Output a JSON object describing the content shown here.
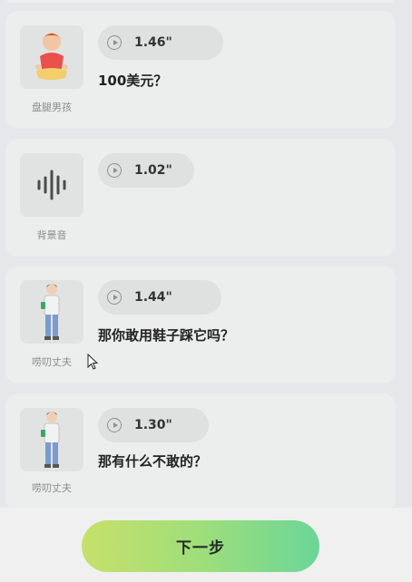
{
  "messages": [
    {
      "role": "盘腿男孩",
      "duration": "1.46\"",
      "text": "100美元？",
      "avatar": "boy-cross-legged-icon"
    },
    {
      "role": "背景音",
      "duration": "1.02\"",
      "text": "",
      "avatar": "sound-wave-icon"
    },
    {
      "role": "唠叨丈夫",
      "duration": "1.44\"",
      "text": "那你敢用鞋子踩它吗？",
      "avatar": "husband-figure-icon"
    },
    {
      "role": "唠叨丈夫",
      "duration": "1.30\"",
      "text": "那有什么不敢的？",
      "avatar": "husband-figure-icon"
    }
  ],
  "footer": {
    "next_label": "下一步"
  },
  "colors": {
    "accent_start": "#c7e06b",
    "accent_end": "#6ad698",
    "card_bg": "#eceeed"
  }
}
